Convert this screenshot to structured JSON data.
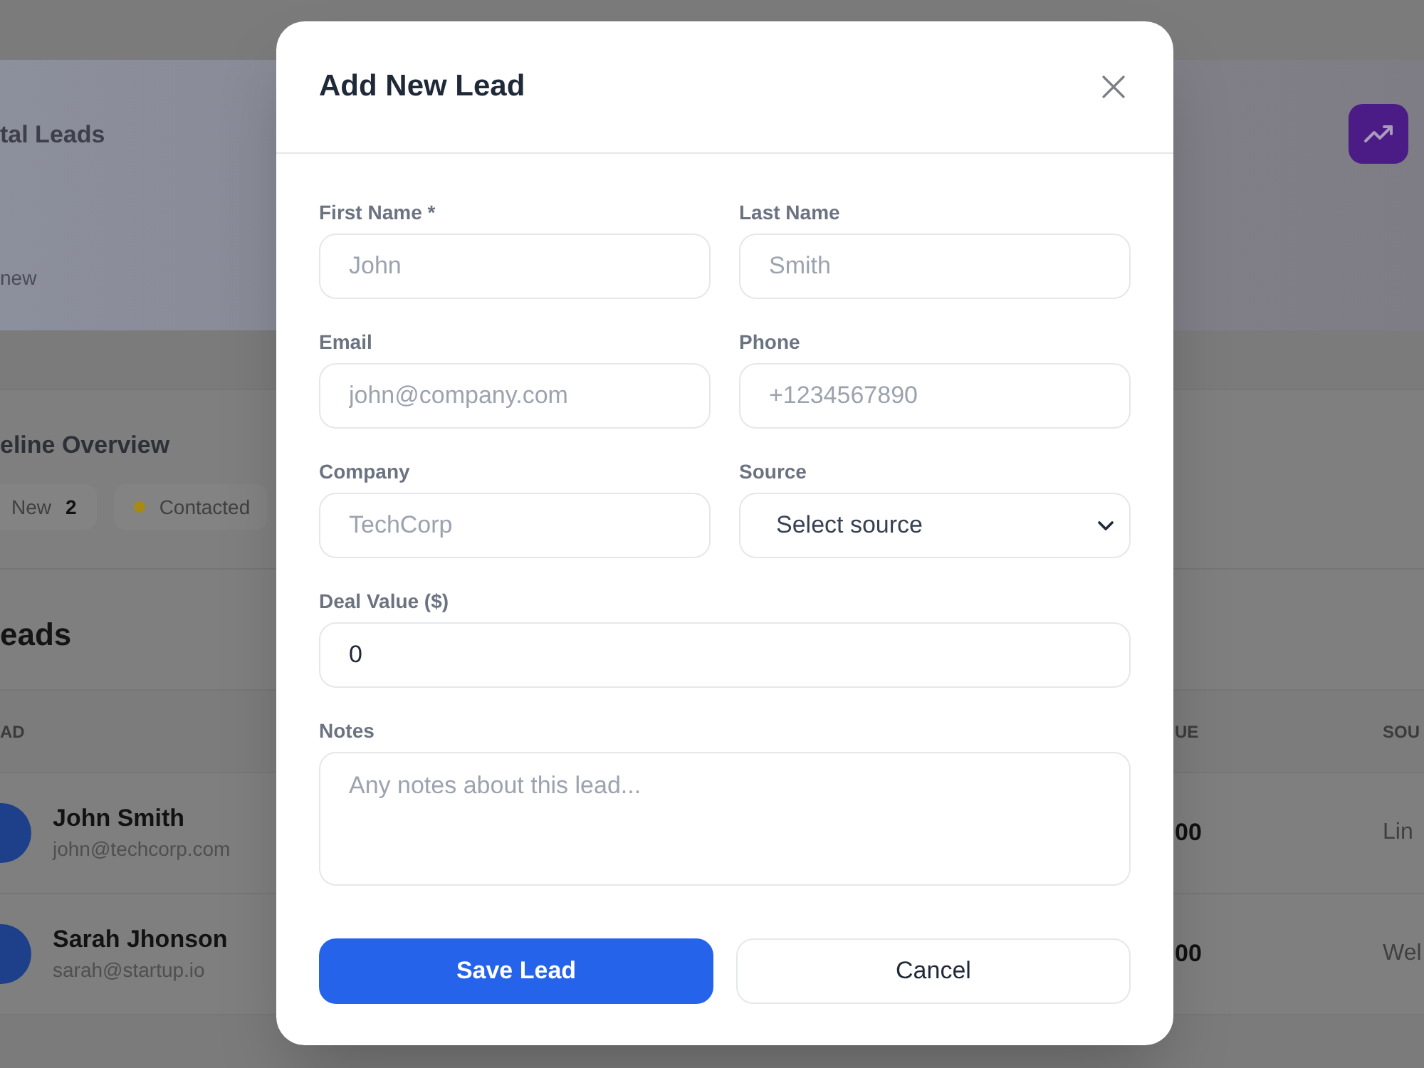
{
  "background": {
    "stat_card": {
      "title": "tal Leads",
      "note": "new"
    },
    "pipeline": {
      "title": "eline Overview",
      "stages": [
        {
          "label": "New",
          "count": "2"
        },
        {
          "label": "Contacted",
          "color": "#a68a14"
        }
      ]
    },
    "leads_table": {
      "title": "eads",
      "columns": [
        "AD",
        "UE",
        "SOU"
      ],
      "rows": [
        {
          "name": "John Smith",
          "email": "john@techcorp.com",
          "value": "00",
          "source": "Lin"
        },
        {
          "name": "Sarah Jhonson",
          "email": "sarah@startup.io",
          "value": "00",
          "source": "Wel"
        }
      ]
    }
  },
  "modal": {
    "title": "Add New Lead",
    "form_rows": [
      [
        {
          "label": "First Name *",
          "kind": "text",
          "placeholder": "John"
        },
        {
          "label": "Last Name",
          "kind": "text",
          "placeholder": "Smith"
        }
      ],
      [
        {
          "label": "Email",
          "kind": "text",
          "placeholder": "john@company.com"
        },
        {
          "label": "Phone",
          "kind": "text",
          "placeholder": "+1234567890"
        }
      ],
      [
        {
          "label": "Company",
          "kind": "text",
          "placeholder": "TechCorp"
        },
        {
          "label": "Source",
          "kind": "select",
          "value": "Select source"
        }
      ],
      [
        {
          "label": "Deal Value ($)",
          "kind": "number",
          "value": "0"
        }
      ],
      [
        {
          "label": "Notes",
          "kind": "textarea",
          "placeholder": "Any notes about this lead..."
        }
      ]
    ],
    "buttons": [
      {
        "label": "Save Lead",
        "kind": "primary"
      },
      {
        "label": "Cancel",
        "kind": "secondary"
      }
    ]
  }
}
